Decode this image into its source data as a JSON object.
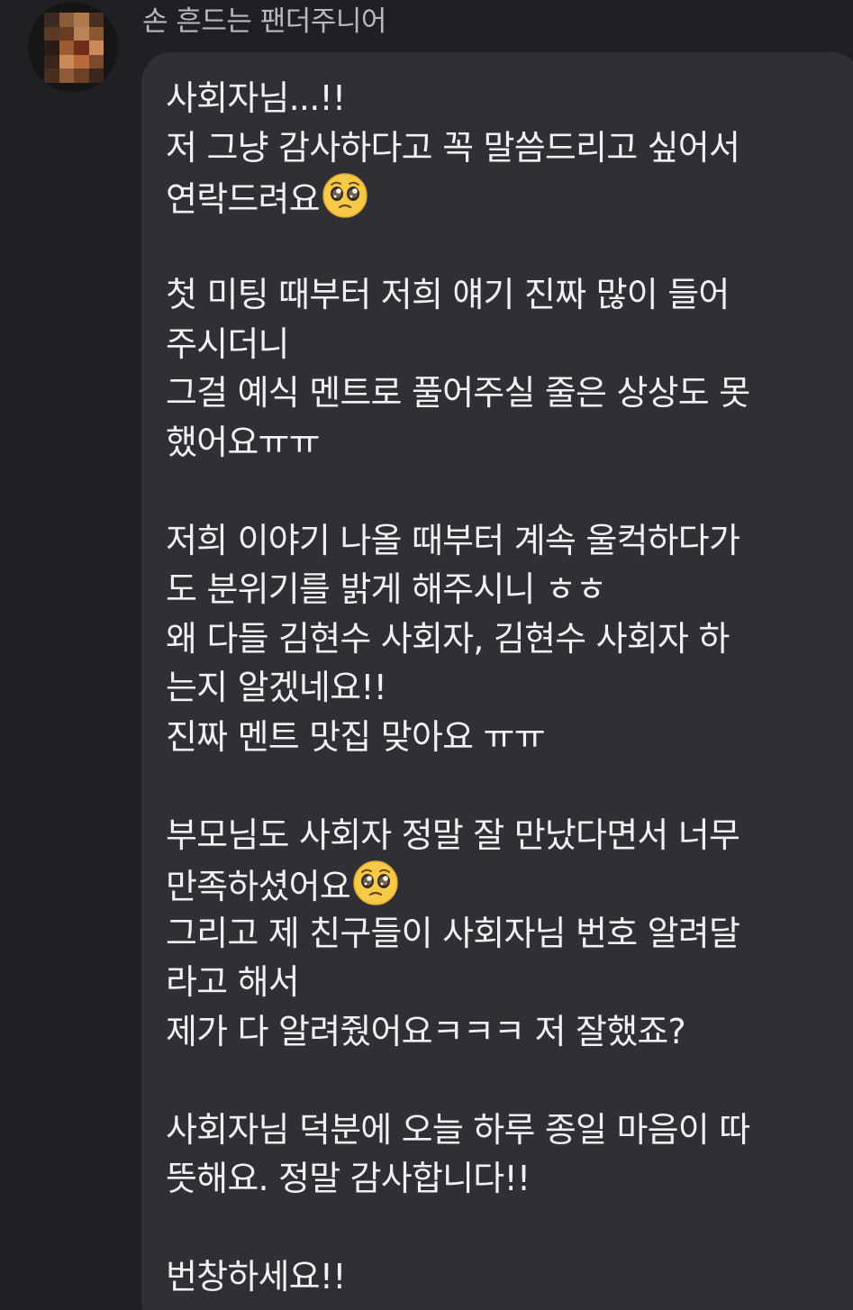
{
  "sender": {
    "name": "손 흔드는 팬더주니어"
  },
  "avatar": {
    "pixel_colors": [
      "#3a2a20",
      "#8b5e3a",
      "#b07a4d",
      "#4a3020",
      "#5b3a25",
      "#6a3d22",
      "#b88457",
      "#8a5830",
      "#2a1c14",
      "#9c5a32",
      "#6e2d18",
      "#c98b5a",
      "#3b251a",
      "#c88c58",
      "#b86a3a",
      "#7b4a2c",
      "#4a2e1d",
      "#8f5a37",
      "#6d4026",
      "#3a261b"
    ]
  },
  "emojis": {
    "pleading": "pleading-face-emoji"
  },
  "message": {
    "lines": [
      {
        "text": "사회자님...!!"
      },
      {
        "text": "저 그냥 감사하다고 꼭 말씀드리고 싶어서"
      },
      {
        "text": "연락드려요",
        "emoji": "pleading"
      },
      {
        "blank": true
      },
      {
        "text": "첫 미팅 때부터 저희 얘기 진짜 많이 들어"
      },
      {
        "text": "주시더니"
      },
      {
        "text": "그걸 예식 멘트로 풀어주실 줄은 상상도 못"
      },
      {
        "text": "했어요ㅠㅠ"
      },
      {
        "blank": true
      },
      {
        "text": "저희 이야기 나올 때부터 계속 울컥하다가"
      },
      {
        "text": "도 분위기를 밝게 해주시니 ㅎㅎ"
      },
      {
        "text": "왜 다들 김현수 사회자, 김현수 사회자 하"
      },
      {
        "text": "는지 알겠네요!!"
      },
      {
        "text": "진짜 멘트 맛집 맞아요 ㅠㅠ"
      },
      {
        "blank": true
      },
      {
        "text": "부모님도 사회자 정말 잘 만났다면서 너무"
      },
      {
        "text": "만족하셨어요",
        "emoji": "pleading"
      },
      {
        "text": "그리고 제 친구들이 사회자님 번호 알려달"
      },
      {
        "text": "라고 해서"
      },
      {
        "text": "제가 다 알려줬어요ㅋㅋㅋ 저 잘했죠?"
      },
      {
        "blank": true
      },
      {
        "text": "사회자님 덕분에 오늘 하루 종일 마음이 따"
      },
      {
        "text": "뜻해요. 정말 감사합니다!!"
      },
      {
        "blank": true
      },
      {
        "text": "번창하세요!!"
      }
    ]
  }
}
